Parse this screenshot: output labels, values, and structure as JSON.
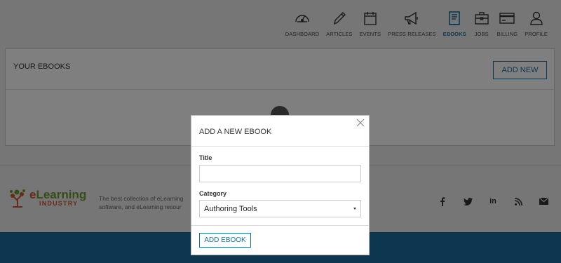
{
  "nav": {
    "items": [
      {
        "label": "DASHBOARD",
        "icon": "gauge-icon"
      },
      {
        "label": "ARTICLES",
        "icon": "pencil-icon"
      },
      {
        "label": "EVENTS",
        "icon": "calendar-icon"
      },
      {
        "label": "PRESS RELEASES",
        "icon": "megaphone-icon"
      },
      {
        "label": "EBOOKS",
        "icon": "book-icon",
        "active": true
      },
      {
        "label": "JOBS",
        "icon": "briefcase-icon"
      },
      {
        "label": "BILLING",
        "icon": "credit-card-icon"
      },
      {
        "label": "PROFILE",
        "icon": "user-icon"
      }
    ],
    "active_color": "#1a6fa0"
  },
  "panel": {
    "title": "YOUR EBOOKS",
    "add_new_label": "ADD NEW"
  },
  "footer": {
    "logo_e": "e",
    "logo_main": "Learning",
    "logo_sub": "INDUSTRY",
    "description_line1": "The best collection of eLearning",
    "description_line2": "software, and eLearning resour",
    "social": [
      "facebook-icon",
      "twitter-icon",
      "linkedin-icon",
      "rss-icon",
      "mail-icon"
    ]
  },
  "modal": {
    "title": "ADD A NEW EBOOK",
    "title_label": "Title",
    "title_value": "",
    "category_label": "Category",
    "category_value": "Authoring Tools",
    "submit_label": "ADD EBOOK"
  },
  "colors": {
    "accent": "#1a6fa0",
    "logo_green": "#6e9a2c",
    "logo_orange": "#d1542a",
    "footer_band": "#1a6fa0"
  }
}
